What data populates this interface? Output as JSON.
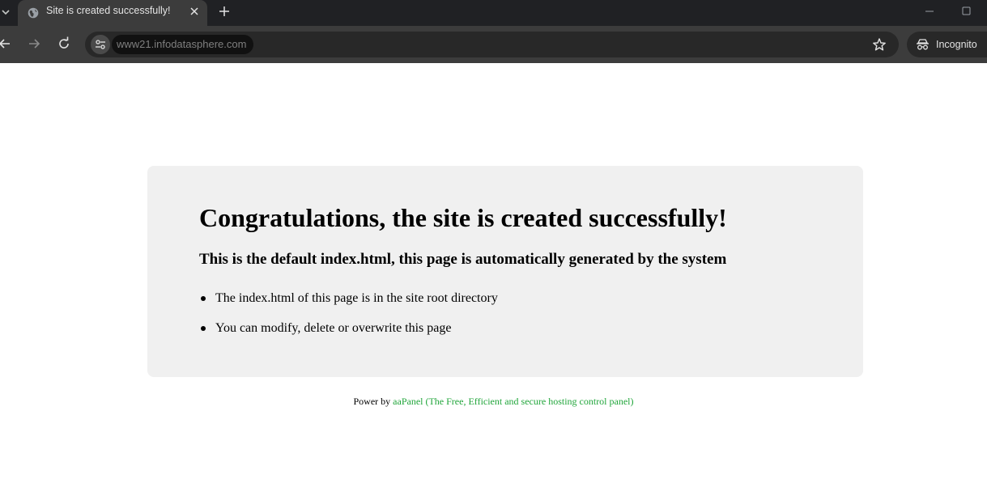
{
  "browser": {
    "tab": {
      "title": "Site is created successfully!"
    },
    "url": "www21.infodatasphere.com",
    "incognito_label": "Incognito",
    "colors": {
      "chrome_dark": "#202124",
      "toolbar": "#3c3c3c",
      "omnibox": "#282828"
    }
  },
  "page": {
    "heading": "Congratulations, the site is created successfully!",
    "subheading": "This is the default index.html, this page is automatically generated by the system",
    "items": [
      "The index.html of this page is in the site root directory",
      "You can modify, delete or overwrite this page"
    ],
    "footer": {
      "prefix": "Power by",
      "link_name": "aaPanel",
      "link_desc": "(The Free, Efficient and secure hosting control panel)"
    },
    "colors": {
      "card_bg": "#f0f0f0",
      "link": "#20a53a"
    }
  }
}
